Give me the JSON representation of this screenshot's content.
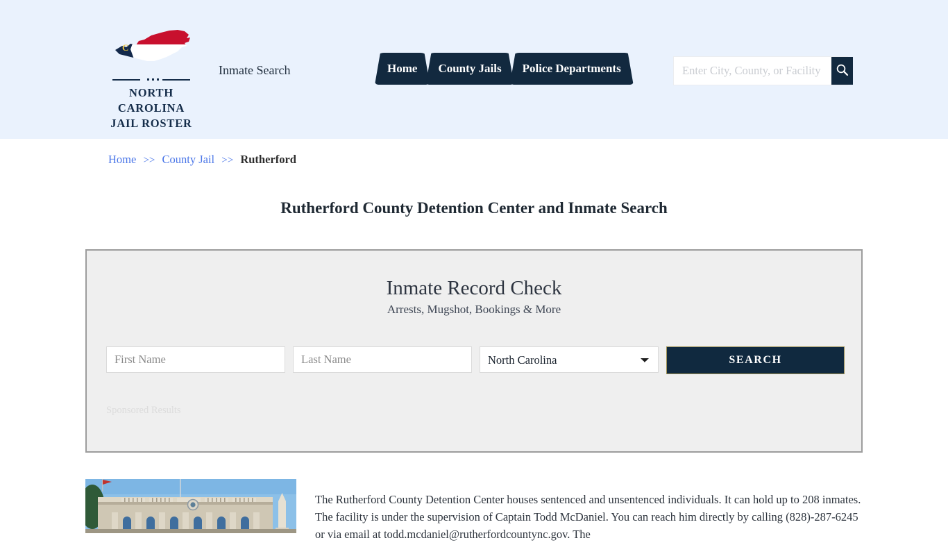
{
  "header": {
    "brand": {
      "line1": "NORTH CAROLINA",
      "line2": "JAIL ROSTER",
      "logo_icon": "north-carolina-state-map-icon"
    },
    "tagline": "Inmate Search",
    "nav": [
      {
        "label": "Home"
      },
      {
        "label": "County Jails"
      },
      {
        "label": "Police Departments"
      }
    ],
    "search": {
      "placeholder": "Enter City, County, or Facility",
      "value": "",
      "button_icon": "search-icon"
    },
    "background_color": "#eaf2fd"
  },
  "breadcrumb": {
    "items": [
      {
        "label": "Home",
        "link": true
      },
      {
        "label": "County Jail",
        "link": true
      },
      {
        "label": "Rutherford",
        "link": false
      }
    ],
    "separator": ">>"
  },
  "page": {
    "title": "Rutherford County Detention Center and Inmate Search"
  },
  "widget": {
    "title": "Inmate Record Check",
    "subtitle": "Arrests, Mugshot, Bookings & More",
    "first_name": {
      "placeholder": "First Name",
      "value": ""
    },
    "last_name": {
      "placeholder": "Last Name",
      "value": ""
    },
    "state": {
      "selected": "North Carolina",
      "options": [
        "North Carolina"
      ]
    },
    "submit_label": "SEARCH",
    "sponsored_label": "Sponsored Results",
    "accent_color": "#10293f",
    "border_color": "#a09356"
  },
  "content": {
    "photo_alt": "rutherford-county-courthouse-photo",
    "paragraph": "The Rutherford County Detention Center houses sentenced and unsentenced individuals. It can hold up to 208 inmates. The facility is under the supervision of Captain Todd McDaniel. You can reach him directly by calling (828)-287-6245 or via email at todd.mcdaniel@rutherfordcountync.gov. The"
  }
}
